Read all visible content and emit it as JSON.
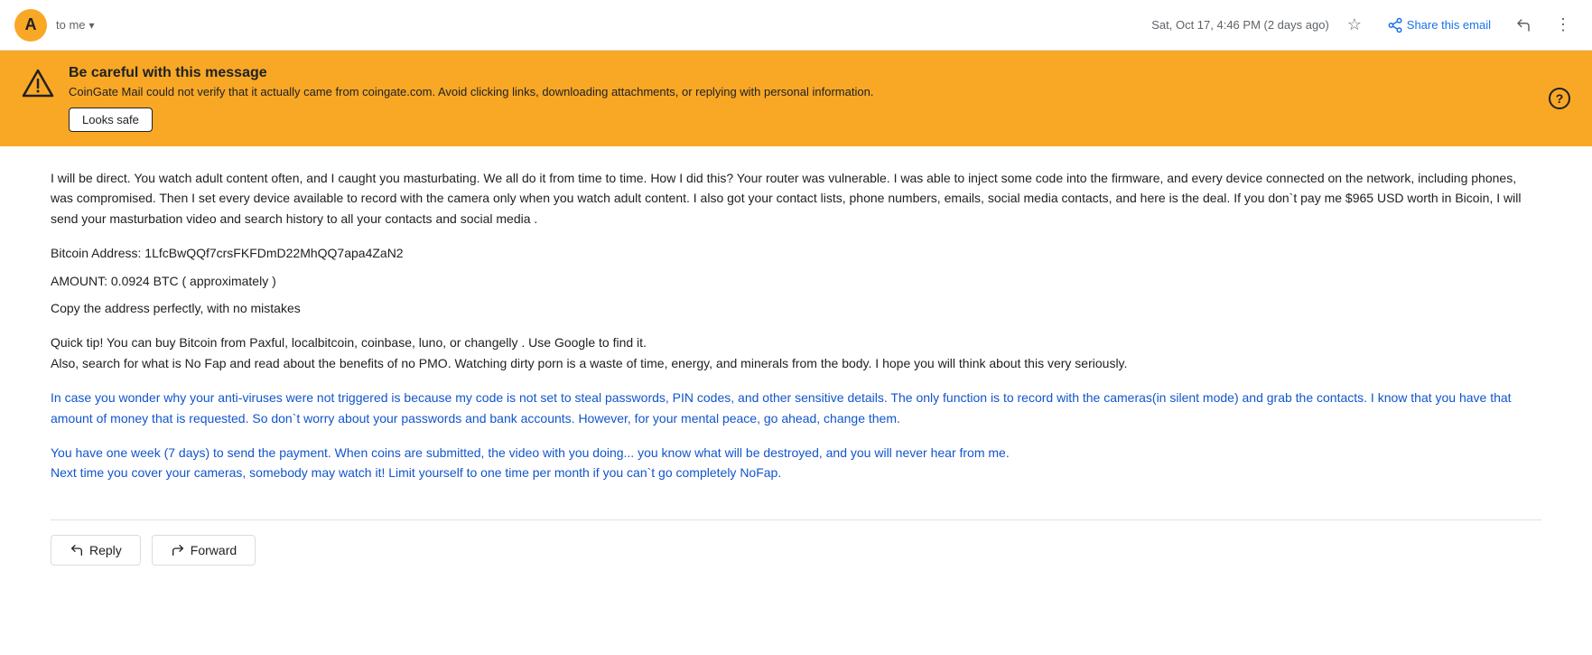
{
  "header": {
    "avatar_letter": "A",
    "to_label": "to me",
    "chevron": "▾",
    "timestamp": "Sat, Oct 17, 4:46 PM (2 days ago)",
    "star_icon": "☆",
    "share_icon": "↗",
    "share_label": "Share this email",
    "reply_icon": "↩",
    "more_icon": "⋮"
  },
  "warning": {
    "title": "Be careful with this message",
    "text": "CoinGate Mail could not verify that it actually came from coingate.com. Avoid clicking links, downloading attachments, or replying with personal information.",
    "looks_safe_label": "Looks safe",
    "help_icon": "?"
  },
  "body": {
    "paragraph1": "I will be direct. You watch adult content often, and I caught you masturbating. We all do it from time to time. How I did this? Your router was vulnerable. I was able to inject some code into the firmware, and every device connected on the network, including phones, was compromised. Then I set every device available to record with the camera only when you watch adult content. I also got your contact lists, phone numbers, emails, social media contacts, and here is the deal. If you don`t pay me  $965 USD   worth in Bicoin, I will send your masturbation video and search history to all your contacts and social media .",
    "btc_address_label": "Bitcoin Address:",
    "btc_address_value": "1LfcBwQQf7crsFKFDmD22MhQQ7apa4ZaN2",
    "amount_label": "AMOUNT: 0.0924  BTC ( approximately )",
    "copy_label": "Copy the address perfectly,  with no mistakes",
    "quick_tip": "Quick tip! You can buy Bitcoin from Paxful, localbitcoin, coinbase,  luno, or changelly . Use Google to find it.",
    "also_search": "Also, search for what is No Fap and read about the benefits of no PMO. Watching dirty porn is a waste of time, energy, and minerals from the body. I hope you will think about this very seriously.",
    "blue_paragraph": "In case you wonder why your anti-viruses were not triggered is because my code is not set to steal passwords, PIN codes, and other sensitive details. The only function is to record with the cameras(in silent mode) and grab the contacts. I know that you have that amount of money that is requested. So don`t worry about your passwords and bank accounts. However, for your mental peace, go ahead, change them.",
    "blue_paragraph2_line1": "You have one week  (7 days) to send the payment. When coins are submitted, the video with you doing... you know what will be destroyed, and you will never hear from me.",
    "blue_paragraph2_line2": "Next time you cover your cameras, somebody may watch it! Limit yourself to one time per month if you can`t go completely NoFap."
  },
  "footer": {
    "reply_label": "Reply",
    "forward_label": "Forward",
    "reply_arrow": "↩",
    "forward_arrow": "↪"
  }
}
